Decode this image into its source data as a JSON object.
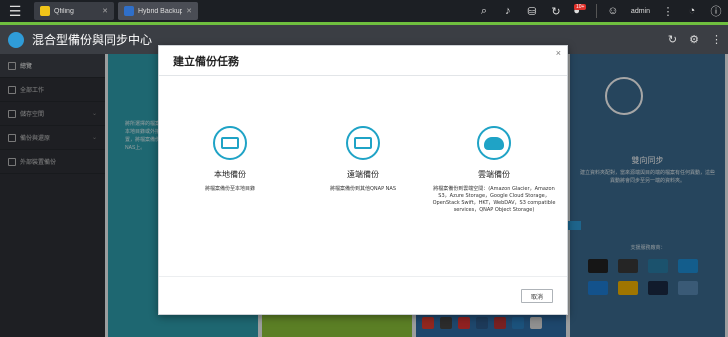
{
  "topbar": {
    "tabs": [
      {
        "label": "Qfiling",
        "color": "#f0c419"
      },
      {
        "label": "Hybrid Backup Sync",
        "color": "#2f6fc9"
      }
    ],
    "notification_count": "10+",
    "username": "admin"
  },
  "app": {
    "title": "混合型備份與同步中心"
  },
  "sidebar": {
    "items": [
      {
        "label": "總覽",
        "active": true
      },
      {
        "label": "全部工作"
      },
      {
        "label": "儲存空間"
      },
      {
        "label": "備份與還原"
      },
      {
        "label": "外部裝置備份"
      }
    ]
  },
  "background": {
    "sync_title": "雙向同步",
    "sync_desc": "建立資料夾配對，當來源端與目的端的檔案有任何異動，這些異動將會同步至另一端的資料夾。",
    "support_label": "支援服務廠商：",
    "teal_desc": "將所選擇的檔案定期備份至本地目錄或外接式儲存裝置，將檔案備份在同一臺NAS上。"
  },
  "modal": {
    "title": "建立備份任務",
    "close": "×",
    "options": [
      {
        "title": "本地備份",
        "desc": "將檔案備份至本地目錄"
      },
      {
        "title": "遠端備份",
        "desc": "將檔案備份到其他QNAP NAS"
      },
      {
        "title": "雲端備份",
        "desc": "將檔案備份到雲端空間：(Amazon Glacier，Amazon S3，Azure Storage，Google Cloud Storage，OpenStack Swift，HKT，WebDAV，S3 compatible services，QNAP Object Storage)"
      }
    ],
    "cancel_label": "取消"
  },
  "colors": {
    "accent_green": "#6fbf3f",
    "brand_teal": "#1fa3c6",
    "card_teal": "#2e9eae",
    "card_green": "#8cc43a",
    "card_blue": "#2f6ea6"
  }
}
